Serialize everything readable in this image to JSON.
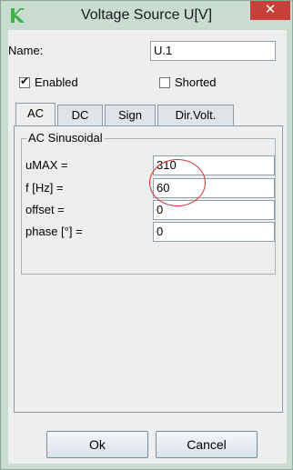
{
  "window": {
    "title": "Voltage Source U[V]",
    "close_glyph": "✕"
  },
  "name_row": {
    "label": "Name:",
    "value": "U.1"
  },
  "checkboxes": [
    {
      "label": "Enabled",
      "checked": true
    },
    {
      "label": "Shorted",
      "checked": false
    }
  ],
  "tabs": [
    {
      "label": "AC",
      "active": true
    },
    {
      "label": "DC",
      "active": false
    },
    {
      "label": "Sign",
      "active": false
    },
    {
      "label": "Dir.Volt.",
      "active": false
    }
  ],
  "group": {
    "title": "AC Sinusoidal",
    "fields": [
      {
        "label": "uMAX =",
        "value": "310"
      },
      {
        "label": "f [Hz] =",
        "value": "60"
      },
      {
        "label": "offset =",
        "value": "0"
      },
      {
        "label": "phase [°] =",
        "value": "0"
      }
    ]
  },
  "buttons": {
    "ok": "Ok",
    "cancel": "Cancel"
  },
  "colors": {
    "annotation_circle": "#e03030",
    "close_button": "#c7403a",
    "frame": "#c9dcd2"
  },
  "icons": {
    "app": "green-k-logo-icon"
  }
}
